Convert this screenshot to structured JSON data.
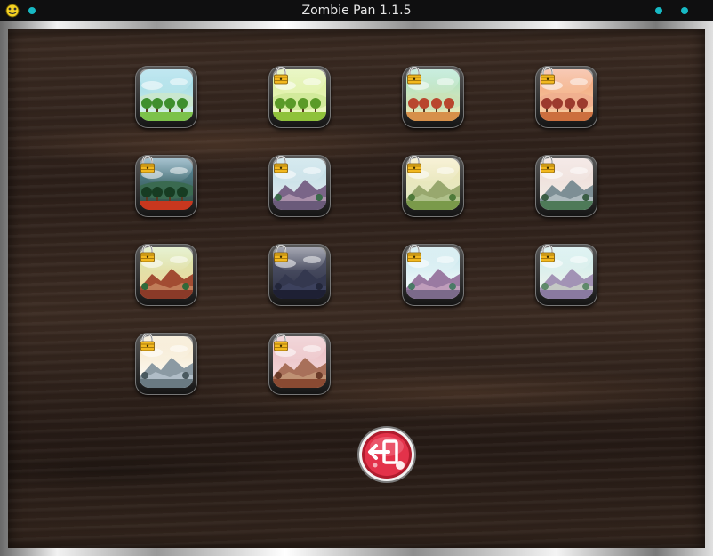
{
  "window": {
    "title": "Zombie Pan 1.1.5"
  },
  "icons": {
    "app": "pygame-snake-icon",
    "lock": "padlock-icon",
    "exit": "exit-door-arrow-icon"
  },
  "colors": {
    "title_bar": "#0f0f10",
    "dot": "#17b9c4",
    "wood": "#2c1f19",
    "exit_button": "#d7263d"
  },
  "levels": [
    {
      "locked": false,
      "theme": "green-forest"
    },
    {
      "locked": true,
      "theme": "lime-forest"
    },
    {
      "locked": true,
      "theme": "autumn-forest"
    },
    {
      "locked": true,
      "theme": "sunset-forest"
    },
    {
      "locked": true,
      "theme": "night-forest-lava"
    },
    {
      "locked": true,
      "theme": "purple-mountains"
    },
    {
      "locked": true,
      "theme": "olive-mountains"
    },
    {
      "locked": true,
      "theme": "misty-mountains"
    },
    {
      "locked": true,
      "theme": "red-canyon"
    },
    {
      "locked": true,
      "theme": "dark-storm"
    },
    {
      "locked": true,
      "theme": "cloudy-mountains"
    },
    {
      "locked": true,
      "theme": "pale-cloudy-mountains"
    },
    {
      "locked": true,
      "theme": "beige-mountains"
    },
    {
      "locked": true,
      "theme": "pink-clouds"
    }
  ]
}
